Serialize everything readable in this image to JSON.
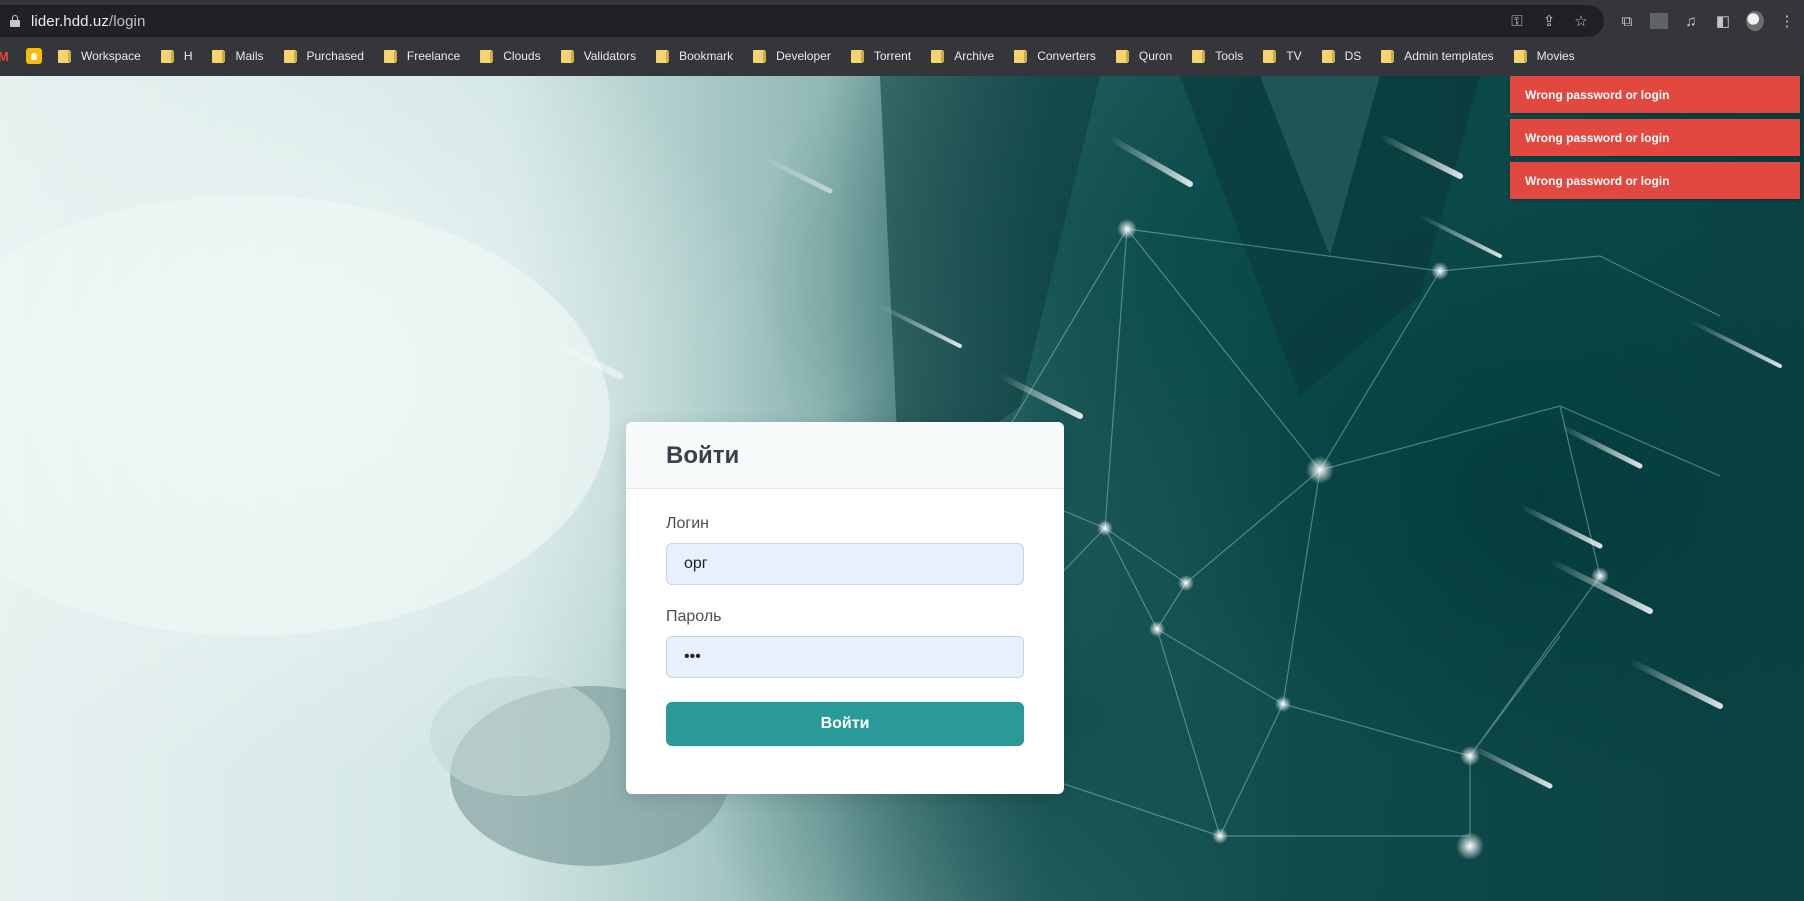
{
  "browser": {
    "url_host": "lider.hdd.uz",
    "url_path": "/login"
  },
  "bookmarks": [
    "Workspace",
    "H",
    "Mails",
    "Purchased",
    "Freelance",
    "Clouds",
    "Validators",
    "Bookmark",
    "Developer",
    "Torrent",
    "Archive",
    "Converters",
    "Quron",
    "Tools",
    "TV",
    "DS",
    "Admin templates",
    "Movies"
  ],
  "toasts": [
    "Wrong password or login",
    "Wrong password or login",
    "Wrong password or login"
  ],
  "colors": {
    "toast": "#e2483f",
    "accent": "#2a9a98"
  },
  "login": {
    "title": "Войти",
    "login_label": "Логин",
    "login_value": "орг",
    "password_label": "Пароль",
    "password_value": "123",
    "submit_label": "Войти"
  }
}
